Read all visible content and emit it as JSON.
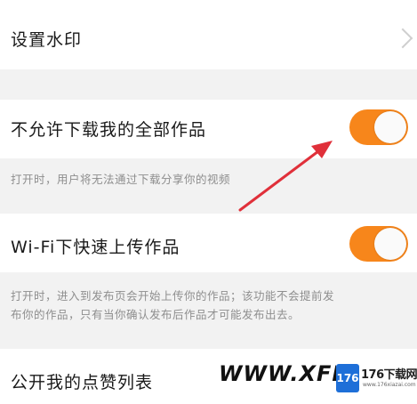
{
  "settings": {
    "watermark_row": {
      "label": "设置水印"
    },
    "block_download": {
      "label": "不允许下载我的全部作品",
      "enabled": true,
      "description": "打开时，用户将无法通过下载分享你的视频"
    },
    "wifi_upload": {
      "label": "Wi-Fi下快速上传作品",
      "enabled": true,
      "description_line1": "打开时，进入到发布页会开始上传你的作品；该功能不会提前发",
      "description_line2": "布你的作品，只有当你确认发布后作品才可能发布出去。"
    },
    "public_likes": {
      "label": "公开我的点赞列表"
    }
  },
  "overlay": {
    "watermark_text": "WWW.XFDOW",
    "logo_badge": "176",
    "logo_text": "176下载网",
    "logo_url": "www.176xiazai.com",
    "arrow_color": "#e0303a"
  },
  "colors": {
    "toggle_on": "#f7861b",
    "background": "#f2f2f2"
  }
}
